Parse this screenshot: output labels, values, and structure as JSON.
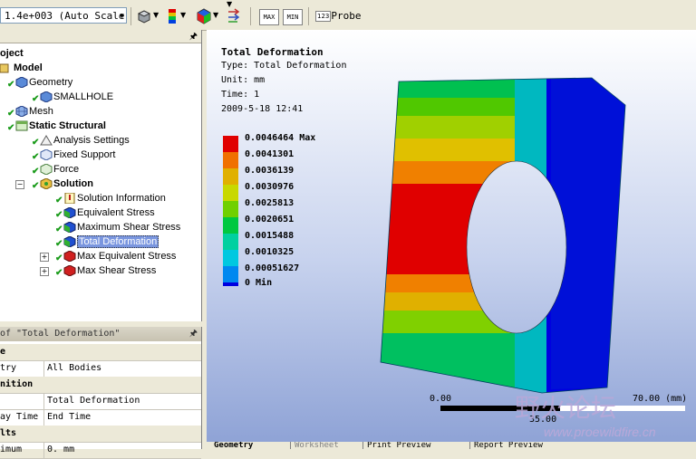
{
  "toolbar": {
    "scale_value": "1.4e+003 (Auto Scale)",
    "max_label": "MAX",
    "min_label": "MIN",
    "probe_label": "Probe",
    "probe_icon_text": "123"
  },
  "tree": {
    "root_label": "oject",
    "items": [
      {
        "label": "Model"
      },
      {
        "label": "Geometry"
      },
      {
        "label": "SMALLHOLE"
      },
      {
        "label": "Mesh"
      },
      {
        "label": "Static Structural"
      },
      {
        "label": "Analysis Settings"
      },
      {
        "label": "Fixed Support"
      },
      {
        "label": "Force"
      },
      {
        "label": "Solution"
      },
      {
        "label": "Solution Information"
      },
      {
        "label": "Equivalent Stress"
      },
      {
        "label": "Maximum Shear Stress"
      },
      {
        "label": "Total Deformation"
      },
      {
        "label": "Max Equivalent Stress"
      },
      {
        "label": "Max Shear Stress"
      }
    ]
  },
  "details": {
    "title": "of \"Total Deformation\"",
    "rows": [
      {
        "key": "e",
        "value": "",
        "category": true
      },
      {
        "key": "try",
        "value": "All Bodies",
        "category": false
      },
      {
        "key": "nition",
        "value": "",
        "category": true
      },
      {
        "key": "",
        "value": "Total Deformation",
        "category": false
      },
      {
        "key": "ay Time",
        "value": "End Time",
        "category": false
      },
      {
        "key": "lts",
        "value": "",
        "category": true
      },
      {
        "key": "imum",
        "value": "0. mm",
        "category": false
      }
    ]
  },
  "viewport": {
    "title": "Total Deformation",
    "type_line": "Type: Total Deformation",
    "unit_line": "Unit: mm",
    "time_line": "Time: 1",
    "date_line": "2009-5-18 12:41",
    "legend": [
      {
        "label": "0.0046464 Max",
        "color": "#e00000"
      },
      {
        "label": "0.0041301",
        "color": "#f07000"
      },
      {
        "label": "0.0036139",
        "color": "#e0b000"
      },
      {
        "label": "0.0030976",
        "color": "#c8d800"
      },
      {
        "label": "0.0025813",
        "color": "#70d000"
      },
      {
        "label": "0.0020651",
        "color": "#00c840"
      },
      {
        "label": "0.0015488",
        "color": "#00d0a0"
      },
      {
        "label": "0.0010325",
        "color": "#00c8e0"
      },
      {
        "label": "0.00051627",
        "color": "#0088f0"
      },
      {
        "label": "0 Min",
        "color": "#0000e0"
      }
    ],
    "scale_start": "0.00",
    "scale_end": "70.00 (mm)",
    "scale_mid": "35.00"
  },
  "tabs": [
    "Geometry",
    "Worksheet",
    "Print Preview",
    "Report Preview"
  ],
  "watermark": {
    "text": "野火论坛",
    "url": "www.proewildfire.cn"
  }
}
